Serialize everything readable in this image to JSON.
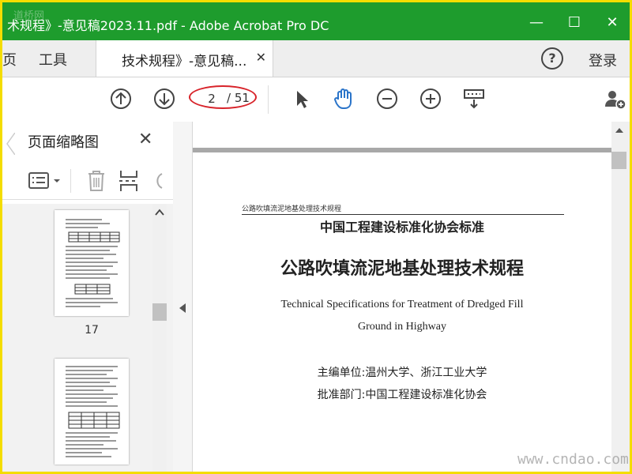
{
  "window": {
    "title": "术规程》-意见稿2023.11.pdf - Adobe Acrobat Pro DC",
    "watermark_logo": "道桥网",
    "minimize": "—",
    "maximize": "☐",
    "close": "✕"
  },
  "tabs": {
    "home_cut": "页",
    "tools": "工具",
    "doc_tab": "技术规程》-意见稿...",
    "doc_close": "✕",
    "help": "?",
    "login": "登录"
  },
  "toolbar": {
    "page_current": "2",
    "page_total": "/ 51"
  },
  "panel": {
    "title": "页面缩略图",
    "close": "✕",
    "thumbnails": [
      {
        "label": "17"
      }
    ]
  },
  "document": {
    "header_small": "公路吹填流泥地基处理技术规程",
    "org_standard": "中国工程建设标准化协会标准",
    "main_title": "公路吹填流泥地基处理技术规程",
    "en_title_line1": "Technical Specifications for Treatment of Dredged Fill",
    "en_title_line2": "Ground in Highway",
    "editor": "主编单位:温州大学、浙江工业大学",
    "approver": "批准部门:中国工程建设标准化协会"
  },
  "footer_watermark": "www.cndao.com",
  "colors": {
    "titlebar": "#1e9c2d",
    "accent_blue": "#2a74c9",
    "annotation_red": "#d8232a"
  }
}
